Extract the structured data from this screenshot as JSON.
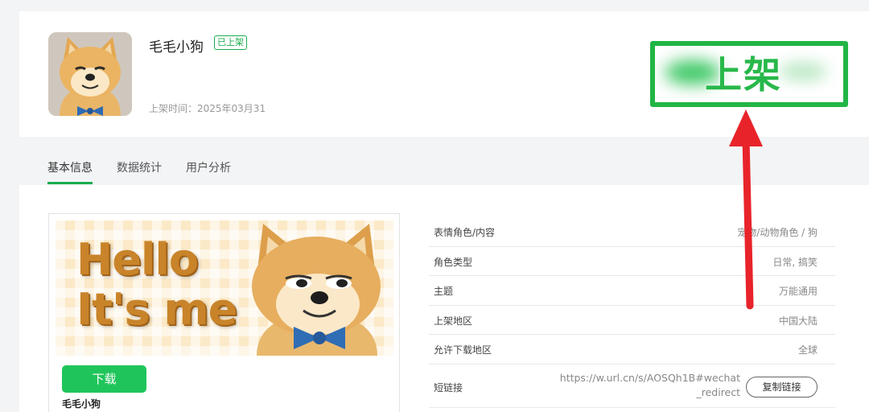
{
  "header": {
    "app_name": "毛毛小狗",
    "status_badge": "已上架",
    "listed_time": "上架时间：2025年03月31",
    "highlight_text": "上架"
  },
  "tabs": [
    {
      "label": "基本信息",
      "active": true
    },
    {
      "label": "数据统计",
      "active": false
    },
    {
      "label": "用户分析",
      "active": false
    }
  ],
  "preview": {
    "banner_text_line1": "Hello",
    "banner_text_line2": "It's me",
    "download_label": "下载",
    "name": "毛毛小狗"
  },
  "info": {
    "rows": [
      {
        "label": "表情角色/内容",
        "value": "宠物/动物角色 / 狗"
      },
      {
        "label": "角色类型",
        "value": "日常, 搞笑"
      },
      {
        "label": "主题",
        "value": "万能通用"
      },
      {
        "label": "上架地区",
        "value": "中国大陆"
      },
      {
        "label": "允许下载地区",
        "value": "全球"
      }
    ],
    "short_link_label": "短链接",
    "short_link_value": "https://w.url.cn/s/AOSQh1B#wechat_redirect",
    "copy_label": "复制链接"
  },
  "colors": {
    "accent": "#1aad4e",
    "highlight": "#22b545",
    "arrow": "#e8232a"
  }
}
